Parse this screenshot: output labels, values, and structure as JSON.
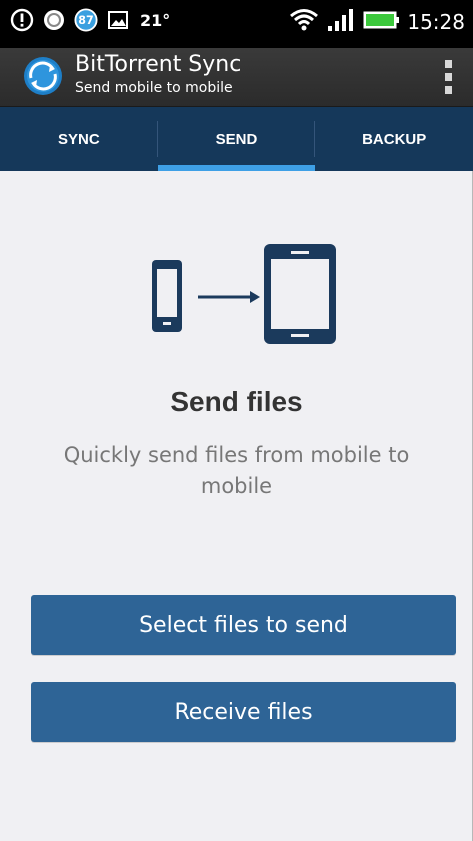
{
  "status_bar": {
    "notification_badge": "87",
    "temperature": "21°",
    "time": "15:28",
    "icons": [
      "alert-icon",
      "sync-status-icon",
      "badge-icon",
      "gallery-icon",
      "wifi-icon",
      "signal-icon",
      "battery-icon"
    ]
  },
  "action_bar": {
    "title": "BitTorrent Sync",
    "subtitle": "Send mobile to mobile"
  },
  "tabs": [
    {
      "label": "SYNC",
      "active": false
    },
    {
      "label": "SEND",
      "active": true
    },
    {
      "label": "BACKUP",
      "active": false
    }
  ],
  "main": {
    "heading": "Send files",
    "description": "Quickly send files from mobile to mobile",
    "select_button": "Select files to send",
    "receive_button": "Receive files"
  },
  "colors": {
    "tab_bar": "#15385a",
    "tab_indicator": "#3ea0e6",
    "button": "#2e6496",
    "illustration": "#1b3a5c",
    "background": "#f0f0f3"
  }
}
